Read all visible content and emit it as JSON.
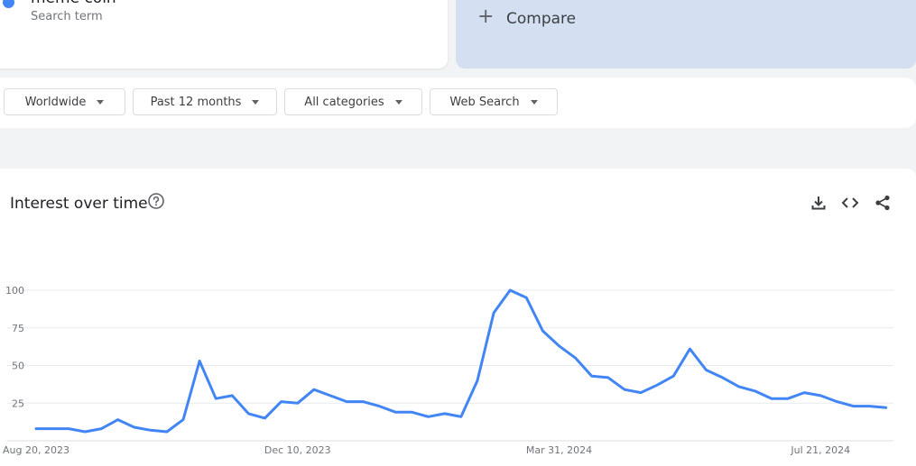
{
  "search_term": {
    "name": "meme coin",
    "subtitle": "Search term",
    "color": "#4285f4"
  },
  "compare": {
    "plus": "+",
    "label": "Compare"
  },
  "filters": [
    {
      "label": "Worldwide"
    },
    {
      "label": "Past 12 months"
    },
    {
      "label": "All categories"
    },
    {
      "label": "Web Search"
    }
  ],
  "chart_panel": {
    "title": "Interest over time",
    "icons": [
      "help-icon",
      "download-icon",
      "embed-icon",
      "share-icon"
    ]
  },
  "chart_data": {
    "type": "line",
    "title": "",
    "xlabel": "",
    "ylabel": "",
    "ylim": [
      0,
      100
    ],
    "y_ticks": [
      25,
      50,
      75,
      100
    ],
    "grid": true,
    "x_tick_labels": [
      {
        "week_index": 0,
        "label": "Aug 20, 2023"
      },
      {
        "week_index": 16,
        "label": "Dec 10, 2023"
      },
      {
        "week_index": 32,
        "label": "Mar 31, 2024"
      },
      {
        "week_index": 48,
        "label": "Jul 21, 2024"
      }
    ],
    "series": [
      {
        "color": "#4285f4",
        "values": [
          8,
          8,
          8,
          6,
          8,
          14,
          9,
          7,
          6,
          14,
          53,
          28,
          30,
          18,
          15,
          26,
          25,
          34,
          30,
          26,
          26,
          23,
          19,
          19,
          16,
          18,
          16,
          40,
          85,
          100,
          95,
          73,
          63,
          55,
          43,
          42,
          34,
          32,
          37,
          43,
          61,
          47,
          42,
          36,
          33,
          28,
          28,
          32,
          30,
          26,
          23,
          23,
          22
        ]
      }
    ]
  }
}
